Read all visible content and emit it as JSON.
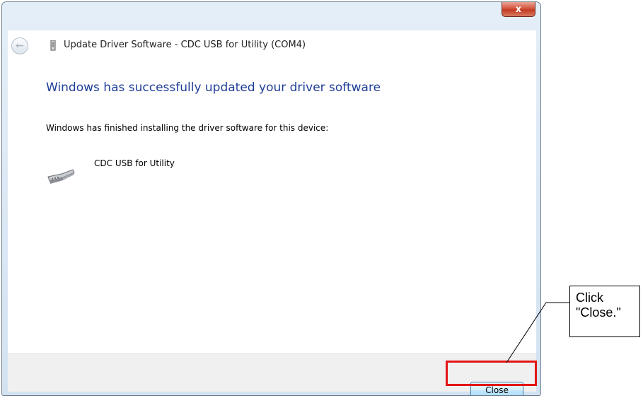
{
  "window": {
    "title": "Update Driver Software - CDC USB for Utility (COM4)",
    "close_glyph": "x",
    "back_glyph": "←"
  },
  "content": {
    "heading": "Windows has successfully updated your driver software",
    "description": "Windows has finished installing the driver software for this device:",
    "device_name": "CDC USB for Utility"
  },
  "footer": {
    "close_label": "Close"
  },
  "annotation": {
    "callout_text": "Click\n\"Close.\"",
    "highlight_color": "#e41515"
  },
  "icons": {
    "back": "back-arrow-icon",
    "usb": "usb-plug-icon",
    "device": "serial-port-icon"
  }
}
